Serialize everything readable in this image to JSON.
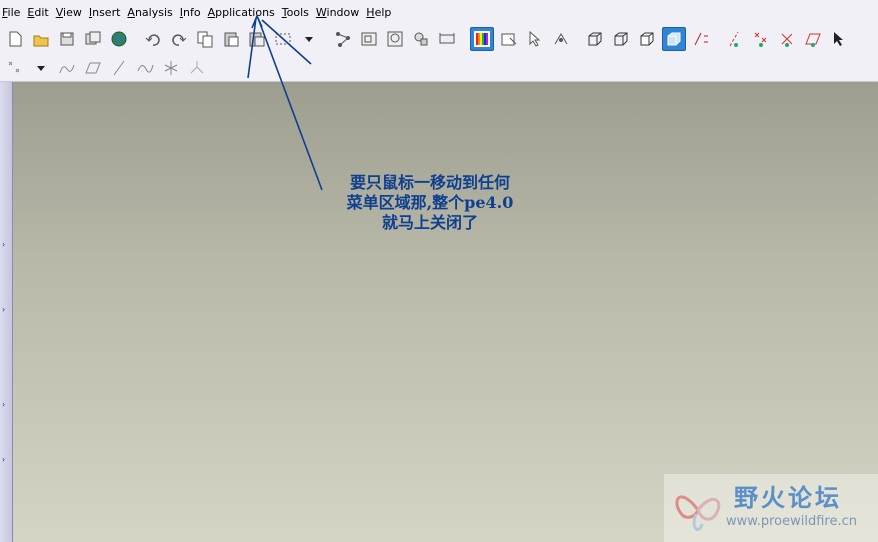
{
  "menu": [
    "File",
    "Edit",
    "View",
    "Insert",
    "Analysis",
    "Info",
    "Applications",
    "Tools",
    "Window",
    "Help"
  ],
  "toolbar_row1": [
    "new-icon",
    "open-folder-icon",
    "save-icon",
    "save-copy-icon",
    "model-tree-globe-icon",
    "sep",
    "undo-icon",
    "redo-icon",
    "copy-icon",
    "paste-icon",
    "paste-special-icon",
    "select-box-icon",
    "dropdown-arrow-icon",
    "sep",
    "regenerate-icon",
    "view-manager-icon",
    "zoom-window-icon",
    "orient-icon",
    "refit-icon",
    "sep",
    "appearance-gallery-icon",
    "select-filter-icon",
    "pointer-icon",
    "spin-center-icon",
    "sep",
    "wireframe-icon",
    "hidden-line-icon",
    "no-hidden-icon",
    "shading-icon",
    "datum-display-icon",
    "sep",
    "datum-axes-icon",
    "point-display-icon",
    "coord-sys-icon",
    "datum-plane-icon",
    "more-arrow-icon"
  ],
  "toolbar_row2": [
    "datum-point-icon",
    "dropdown-arrow-icon",
    "sketch-icon",
    "datum-plane-tool-icon",
    "axis-tool-icon",
    "curve-icon",
    "point-tool-icon",
    "coord-tool-icon"
  ],
  "annotation": {
    "line1": "要只鼠标一移动到任何",
    "line2": "菜单区域那,整个pe4.0",
    "line3": "就马上关闭了",
    "color": "#0f3f8f"
  },
  "watermark": {
    "title": "野火论坛",
    "url": "www.proewildfire.cn"
  },
  "colors": {
    "menubar_bg": "#f1f0f6",
    "graphics_top": "#9e9e90",
    "graphics_bottom": "#d5d5c6",
    "selected_tool": "#2f86d6"
  }
}
